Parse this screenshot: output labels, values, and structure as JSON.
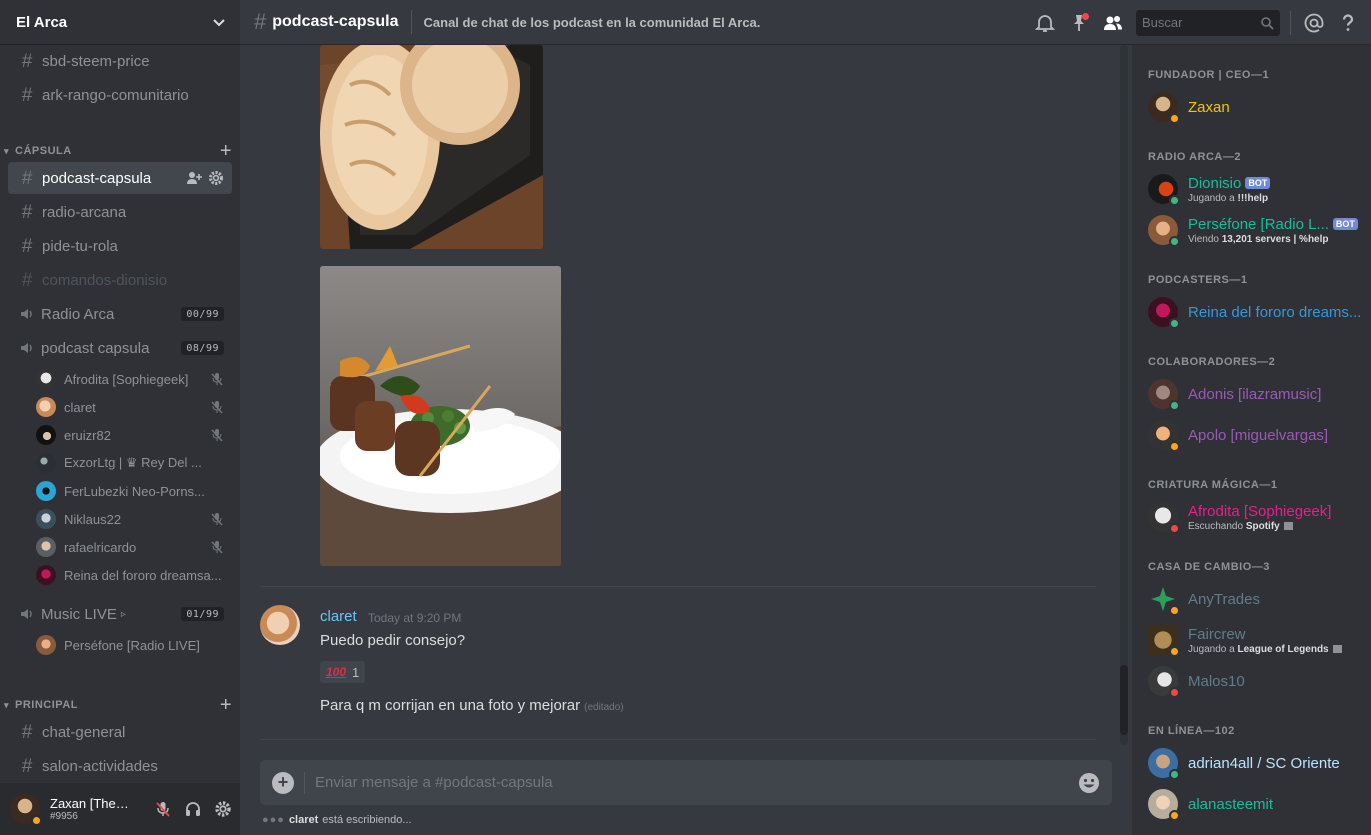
{
  "guild": {
    "name": "El Arca"
  },
  "channels": {
    "top": [
      {
        "name": "sbd-steem-price"
      },
      {
        "name": "ark-rango-comunitario"
      }
    ],
    "capsula": {
      "label": "CÁPSULA",
      "text": [
        {
          "name": "podcast-capsula",
          "active": true
        },
        {
          "name": "radio-arcana"
        },
        {
          "name": "pide-tu-rola"
        },
        {
          "name": "comandos-dionisio",
          "locked": true
        }
      ],
      "voice": [
        {
          "name": "Radio Arca",
          "count": "00/99"
        },
        {
          "name": "podcast capsula",
          "count": "08/99"
        }
      ],
      "voice_users": [
        {
          "name": "Afrodita [Sophiegeek]"
        },
        {
          "name": "claret"
        },
        {
          "name": "eruizr82"
        },
        {
          "name": "ExzorLtg | ♛ Rey Del ..."
        },
        {
          "name": "FerLubezki Neo-Porns..."
        },
        {
          "name": "Niklaus22"
        },
        {
          "name": "rafaelricardo"
        },
        {
          "name": "Reina del fororo dreamsa..."
        }
      ],
      "music": {
        "name": "Music LIVE",
        "count": "01/99",
        "arrow": "▹",
        "user": "Perséfone [Radio LIVE]"
      }
    },
    "principal": {
      "label": "PRINCIPAL",
      "text": [
        {
          "name": "chat-general"
        },
        {
          "name": "salon-actividades"
        }
      ]
    }
  },
  "user_panel": {
    "name": "Zaxan [The ...",
    "discriminator": "#9956",
    "status_color": "#faa61a"
  },
  "header": {
    "channel": "podcast-capsula",
    "topic": "Canal de chat de los podcast en la comunidad El Arca.",
    "search_placeholder": "Buscar"
  },
  "message": {
    "author": "claret",
    "timestamp": "Today at 9:20 PM",
    "lines": [
      "Puedo pedir consejo?",
      "Para q m corrijan en una foto y mejorar"
    ],
    "edited": "(editado)",
    "reaction": {
      "emoji": "💯",
      "emoji_text": "100",
      "count": "1"
    }
  },
  "composer": {
    "placeholder": "Enviar mensaje a #podcast-capsula"
  },
  "typing": {
    "user": "claret",
    "text": "está escribiendo..."
  },
  "members": {
    "roles": [
      {
        "label": "FUNDADOR | CEO—1",
        "members": [
          {
            "name": "Zaxan",
            "color": "#f1c40f",
            "status": "#faa61a"
          }
        ]
      },
      {
        "label": "RADIO ARCA—2",
        "members": [
          {
            "name": "Dionisio",
            "color": "#1abc9c",
            "bot": "BOT",
            "status": "#43b581",
            "activity_prefix": "Jugando a",
            "activity": "!!!help"
          },
          {
            "name": "Perséfone [Radio L...",
            "color": "#1abc9c",
            "bot": "BOT",
            "status": "#43b581",
            "activity_prefix": "Viendo",
            "activity": "13,201 servers | %help"
          }
        ]
      },
      {
        "label": "PODCASTERS—1",
        "members": [
          {
            "name": "Reina del fororo dreams...",
            "color": "#3498db",
            "status": "#43b581"
          }
        ]
      },
      {
        "label": "COLABORADORES—2",
        "members": [
          {
            "name": "Adonis [ilazramusic]",
            "color": "#9b59b6",
            "status": "#43b581"
          },
          {
            "name": "Apolo [miguelvargas]",
            "color": "#9b59b6",
            "status": "#faa61a"
          }
        ]
      },
      {
        "label": "CRIATURA MÁGICA—1",
        "members": [
          {
            "name": "Afrodita [Sophiegeek]",
            "color": "#e91e8c",
            "status": "#f04747",
            "activity_prefix": "Escuchando",
            "activity": "Spotify"
          }
        ]
      },
      {
        "label": "CASA DE CAMBIO—3",
        "members": [
          {
            "name": "AnyTrades",
            "color": "#607d8b",
            "status": "#faa61a"
          },
          {
            "name": "Faircrew",
            "color": "#607d8b",
            "status": "#faa61a",
            "activity_prefix": "Jugando a",
            "activity": "League of Legends"
          },
          {
            "name": "Malos10",
            "color": "#607d8b",
            "status": "#f04747"
          }
        ]
      },
      {
        "label": "EN LÍNEA—102",
        "members": [
          {
            "name": "adrian4all / SC Oriente",
            "color": "#b9e3ff",
            "status": "#43b581"
          },
          {
            "name": "alanasteemit",
            "color": "#1abc9c",
            "status": "#faa61a"
          }
        ]
      }
    ]
  },
  "colors": {
    "accent": "#7289da",
    "online": "#43b581",
    "idle": "#faa61a",
    "dnd": "#f04747"
  },
  "icons": [
    "chevron-down-icon",
    "hash-icon",
    "lock-hash-icon",
    "speaker-icon",
    "invite-icon",
    "gear-icon",
    "mic-muted-icon",
    "bell-icon",
    "pin-icon",
    "members-icon",
    "search-icon",
    "mention-icon",
    "help-icon",
    "plus-icon",
    "emoji-icon",
    "headset-icon"
  ]
}
